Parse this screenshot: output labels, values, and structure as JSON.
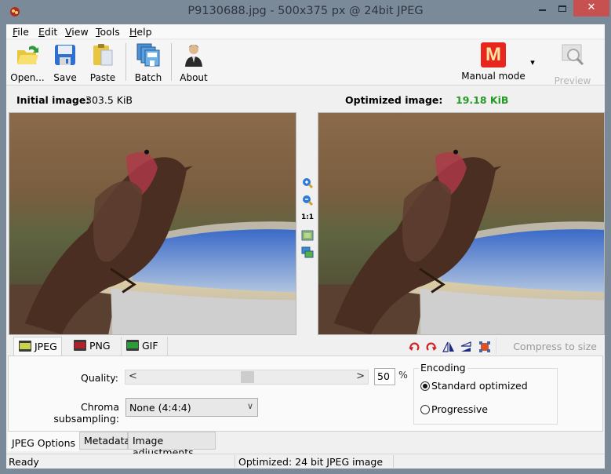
{
  "window": {
    "title": "P9130688.jpg - 500x375 px @ 24bit JPEG",
    "min_label": "minimize",
    "max_label": "maximize",
    "close_glyph": "✕"
  },
  "menu": {
    "items": [
      {
        "label": "File",
        "mnemonic": "F",
        "rest": "ile"
      },
      {
        "label": "Edit",
        "mnemonic": "E",
        "rest": "dit"
      },
      {
        "label": "View",
        "mnemonic": "V",
        "rest": "iew"
      },
      {
        "label": "Tools",
        "mnemonic": "T",
        "rest": "ools"
      },
      {
        "label": "Help",
        "mnemonic": "H",
        "rest": "elp"
      }
    ]
  },
  "toolbar": {
    "open_label": "Open...",
    "save_label": "Save",
    "paste_label": "Paste",
    "batch_label": "Batch",
    "about_label": "About",
    "mode_label": "Manual mode",
    "mode_letter": "M",
    "preview_label": "Preview",
    "dropdown_glyph": "▾"
  },
  "sizes": {
    "initial_label": "Initial image:",
    "initial_value": "303.5 KiB",
    "optimized_label": "Optimized image:",
    "optimized_value": "19.18 KiB",
    "optimized_color": "#259a23"
  },
  "zoom_strip": {
    "zoom_in": "zoom-in",
    "zoom_out": "zoom-out",
    "actual_size_label": "1:1",
    "fit": "fit-to-window",
    "compare": "compare"
  },
  "format_tabs": [
    {
      "label": "JPEG",
      "badge": "JPG",
      "badge_color": "#c8d24a",
      "active": true
    },
    {
      "label": "PNG",
      "badge": "PNG",
      "badge_color": "#b0202a",
      "active": false
    },
    {
      "label": "GIF",
      "badge": "GIF",
      "badge_color": "#2c9b3a",
      "active": false
    }
  ],
  "image_tools": {
    "rotate_left": "rotate-left",
    "rotate_right": "rotate-right",
    "flip_horizontal": "flip-horizontal",
    "flip_vertical": "flip-vertical",
    "crop": "crop",
    "compress_label": "Compress to size"
  },
  "jpeg_options": {
    "quality_label": "Quality:",
    "quality_value": "50",
    "quality_fraction": 0.5,
    "percent_sign": "%",
    "slider_left": "<",
    "slider_right": ">",
    "chroma_label": "Chroma subsampling:",
    "chroma_value": "None (4:4:4)",
    "chevron": "⌄",
    "encoding_title": "Encoding",
    "encoding_options": [
      {
        "label": "Standard optimized",
        "selected": true
      },
      {
        "label": "Progressive",
        "selected": false
      }
    ]
  },
  "option_tabs": [
    {
      "label": "JPEG Options",
      "active": true
    },
    {
      "label": "Metadata",
      "active": false
    },
    {
      "label": "Image adjustments",
      "active": false
    }
  ],
  "status": {
    "left": "Ready",
    "middle": "Optimized: 24 bit JPEG image",
    "right": ""
  }
}
